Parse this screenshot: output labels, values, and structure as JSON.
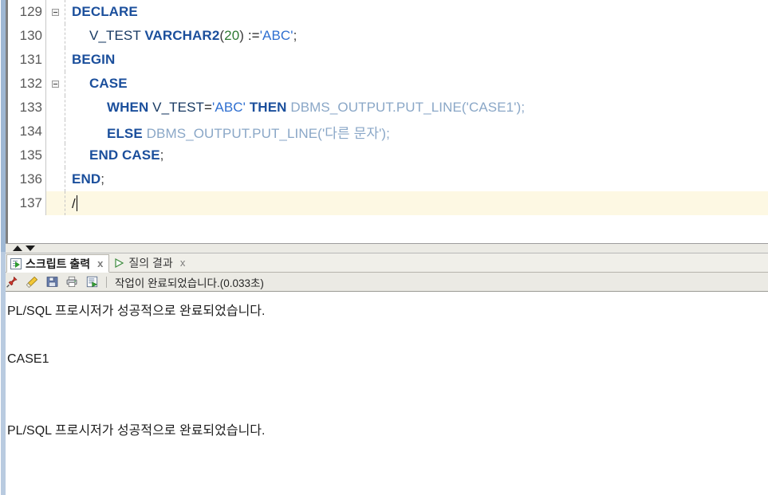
{
  "editor": {
    "lines": [
      {
        "number": "129",
        "fold": true,
        "indent": 0,
        "highlighted": false,
        "tokens": [
          {
            "text": "DECLARE",
            "type": "keyword"
          }
        ]
      },
      {
        "number": "130",
        "fold": false,
        "indent": 2,
        "highlighted": false,
        "tokens": [
          {
            "text": "V_TEST",
            "type": "identifier"
          },
          {
            "text": " ",
            "type": "plain"
          },
          {
            "text": "VARCHAR2",
            "type": "keyword"
          },
          {
            "text": "(",
            "type": "punct"
          },
          {
            "text": "20",
            "type": "number"
          },
          {
            "text": ")",
            "type": "punct"
          },
          {
            "text": " :=",
            "type": "operator"
          },
          {
            "text": "'ABC'",
            "type": "string"
          },
          {
            "text": ";",
            "type": "punct"
          }
        ]
      },
      {
        "number": "131",
        "fold": false,
        "indent": 0,
        "highlighted": false,
        "tokens": [
          {
            "text": "BEGIN",
            "type": "keyword"
          }
        ]
      },
      {
        "number": "132",
        "fold": true,
        "indent": 2,
        "highlighted": false,
        "tokens": [
          {
            "text": "CASE",
            "type": "keyword"
          }
        ]
      },
      {
        "number": "133",
        "fold": false,
        "indent": 4,
        "highlighted": false,
        "tokens": [
          {
            "text": "WHEN",
            "type": "keyword"
          },
          {
            "text": " ",
            "type": "plain"
          },
          {
            "text": "V_TEST",
            "type": "identifier"
          },
          {
            "text": "=",
            "type": "operator"
          },
          {
            "text": "'ABC'",
            "type": "string"
          },
          {
            "text": " ",
            "type": "plain"
          },
          {
            "text": "THEN",
            "type": "keyword"
          },
          {
            "text": " ",
            "type": "plain"
          },
          {
            "text": "DBMS_OUTPUT.PUT_LINE('CASE1');",
            "type": "function"
          }
        ]
      },
      {
        "number": "134",
        "fold": false,
        "indent": 4,
        "highlighted": false,
        "tokens": [
          {
            "text": "ELSE",
            "type": "keyword"
          },
          {
            "text": " ",
            "type": "plain"
          },
          {
            "text": "DBMS_OUTPUT.PUT_LINE('다른 문자');",
            "type": "function"
          }
        ]
      },
      {
        "number": "135",
        "fold": false,
        "indent": 2,
        "highlighted": false,
        "tokens": [
          {
            "text": "END CASE",
            "type": "keyword"
          },
          {
            "text": ";",
            "type": "punct"
          }
        ]
      },
      {
        "number": "136",
        "fold": false,
        "indent": 0,
        "highlighted": false,
        "tokens": [
          {
            "text": "END",
            "type": "keyword"
          },
          {
            "text": ";",
            "type": "punct"
          }
        ]
      },
      {
        "number": "137",
        "fold": false,
        "indent": 0,
        "highlighted": true,
        "caret": true,
        "tokens": [
          {
            "text": "/",
            "type": "slash"
          }
        ]
      }
    ]
  },
  "splitter": {
    "expand_icon": "triangle-up-icon",
    "collapse_icon": "triangle-down-icon"
  },
  "output_panel": {
    "tabs": [
      {
        "label": "스크립트 출력",
        "icon": "script-output-icon",
        "active": true,
        "close": "x"
      },
      {
        "label": "질의 결과",
        "icon": "play-icon",
        "active": false,
        "close": "x"
      }
    ],
    "toolbar": {
      "buttons": [
        {
          "name": "pin-icon",
          "title": "고정"
        },
        {
          "name": "eraser-icon",
          "title": "지우기"
        },
        {
          "name": "save-icon",
          "title": "저장"
        },
        {
          "name": "print-icon",
          "title": "인쇄"
        },
        {
          "name": "run-script-icon",
          "title": "스크립트 실행"
        }
      ],
      "status": "작업이 완료되었습니다.(0.033초)"
    },
    "console_lines": [
      "PL/SQL 프로시저가 성공적으로 완료되었습니다.",
      "",
      "CASE1",
      "",
      "",
      "PL/SQL 프로시저가 성공적으로 완료되었습니다."
    ]
  },
  "colors": {
    "keyword": "#1b4f9c",
    "identifier": "#183a63",
    "string": "#2f6fd0",
    "number": "#2f7a33",
    "function": "#8aa7c7",
    "highlight_line_bg": "#fdf8e3",
    "panel_bg": "#f0efe9",
    "rail_blue": "#9fb8d4"
  }
}
